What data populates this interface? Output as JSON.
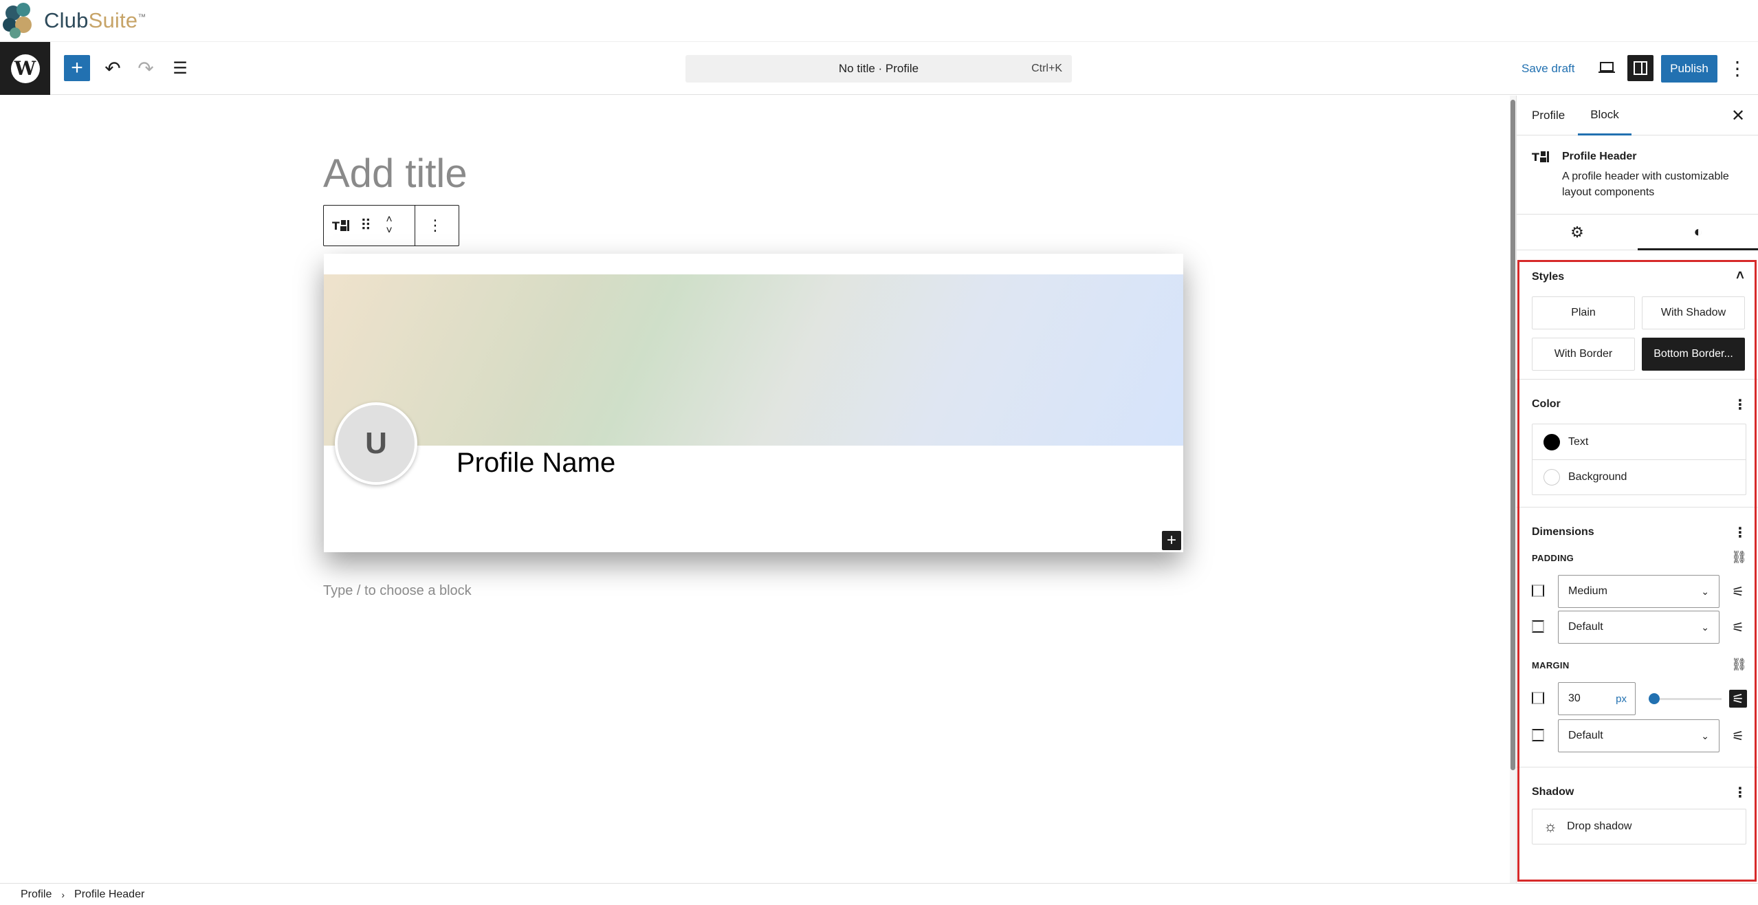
{
  "brand": {
    "name_part1": "Club",
    "name_part2": "Suite",
    "trademark": "™"
  },
  "toolbar": {
    "inserter_icon": "+",
    "undo_icon": "↶",
    "redo_icon": "↷",
    "list_view_icon": "☰",
    "document_title": "No title · Profile",
    "shortcut": "Ctrl+K",
    "save_draft": "Save draft",
    "publish": "Publish",
    "more_icon": "⋮"
  },
  "canvas": {
    "title_placeholder": "Add title",
    "block_placeholder": "Type / to choose a block",
    "profile_header": {
      "avatar_initial": "U",
      "profile_name": "Profile Name"
    }
  },
  "sidebar": {
    "tabs": [
      {
        "label": "Profile"
      },
      {
        "label": "Block"
      }
    ],
    "active_tab": "Block",
    "block": {
      "title": "Profile Header",
      "description": "A profile header with customizable layout components"
    },
    "styles": {
      "title": "Styles",
      "options": [
        {
          "label": "Plain"
        },
        {
          "label": "With Shadow"
        },
        {
          "label": "With Border"
        },
        {
          "label": "Bottom Border..."
        }
      ],
      "active": "Bottom Border..."
    },
    "color": {
      "title": "Color",
      "items": [
        {
          "label": "Text",
          "swatch": "#000000"
        },
        {
          "label": "Background",
          "swatch": "#ffffff"
        }
      ]
    },
    "dimensions": {
      "title": "Dimensions",
      "padding_label": "PADDING",
      "padding_vertical": "Medium",
      "padding_horizontal": "Default",
      "margin_label": "MARGIN",
      "margin_vertical_value": "30",
      "margin_unit": "px",
      "margin_horizontal": "Default"
    },
    "shadow": {
      "title": "Shadow",
      "button": "Drop shadow"
    }
  },
  "breadcrumb": [
    "Profile",
    "Profile Header"
  ],
  "colors": {
    "accent": "#2271b1",
    "highlight": "#d72a2a",
    "dark": "#1e1e1e"
  }
}
